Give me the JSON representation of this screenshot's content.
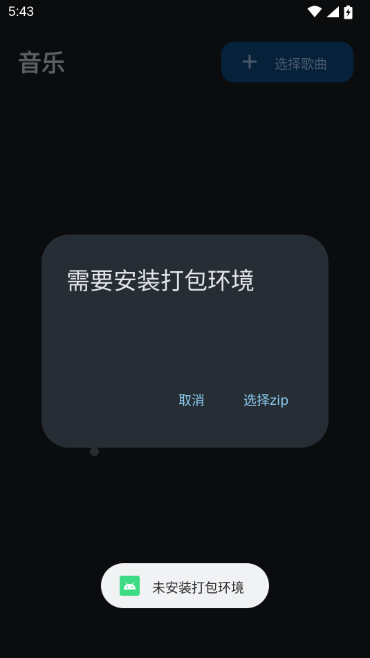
{
  "status_bar": {
    "time": "5:43",
    "icons": [
      "wifi-icon",
      "cell-signal-icon",
      "battery-charging-icon"
    ]
  },
  "app_bar": {
    "title": "音乐",
    "select_button_label": "选择歌曲",
    "select_button_icon": "plus-icon"
  },
  "dialog": {
    "title": "需要安装打包环境",
    "cancel_label": "取消",
    "confirm_label": "选择zip"
  },
  "toast": {
    "icon": "android-icon",
    "message": "未安装打包环境"
  },
  "colors": {
    "background": "#0b0c0e",
    "dialog_surface": "#262d35",
    "dialog_button_text": "#8ccdf2",
    "toast_surface": "#f1f2f3",
    "android_green": "#3ddc84"
  }
}
